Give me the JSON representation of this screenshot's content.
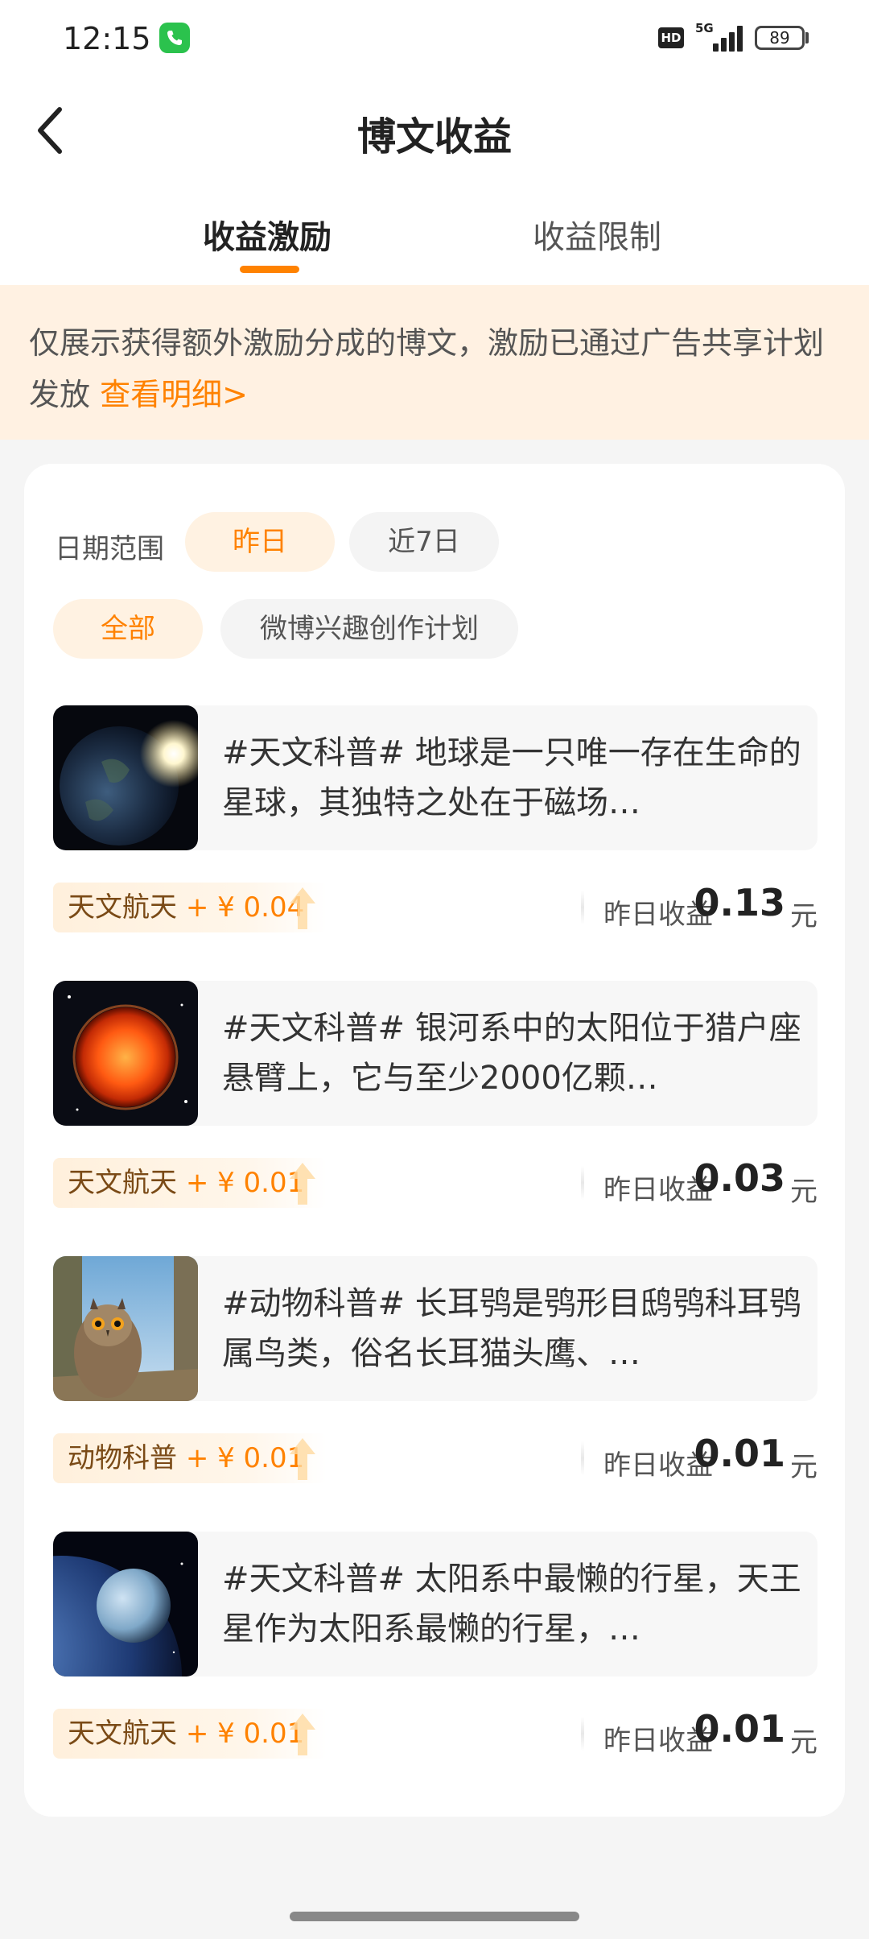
{
  "status_bar": {
    "time": "12:15",
    "hd": "HD",
    "network": "5G",
    "battery": "89"
  },
  "header": {
    "title": "博文收益"
  },
  "tabs": [
    {
      "label": "收益激励",
      "active": true
    },
    {
      "label": "收益限制",
      "active": false
    }
  ],
  "notice": {
    "text": "仅展示获得额外激励分成的博文，激励已通过广告共享计划发放 ",
    "link": "查看明细>"
  },
  "filters": {
    "date_label": "日期范围",
    "date_options": [
      {
        "label": "昨日",
        "active": true
      },
      {
        "label": "近7日",
        "active": false
      }
    ],
    "type_options": [
      {
        "label": "全部",
        "active": true
      },
      {
        "label": "微博兴趣创作计划",
        "active": false
      }
    ]
  },
  "posts": [
    {
      "thumbnail": "earth-image",
      "text": "#天文科普# 地球是一只唯一存在生命的星球，其独特之处在于磁场…",
      "category": "天文航天",
      "bonus": "+ ¥ 0.04",
      "earn_label": "昨日收益",
      "earn_value": "0.13",
      "unit": "元"
    },
    {
      "thumbnail": "sun-image",
      "text": "#天文科普# 银河系中的太阳位于猎户座悬臂上，它与至少2000亿颗…",
      "category": "天文航天",
      "bonus": "+ ¥ 0.01",
      "earn_label": "昨日收益",
      "earn_value": "0.03",
      "unit": "元"
    },
    {
      "thumbnail": "owl-image",
      "text": "#动物科普# 长耳鸮是鸮形目鸱鸮科耳鸮属鸟类，俗名长耳猫头鹰、…",
      "category": "动物科普",
      "bonus": "+ ¥ 0.01",
      "earn_label": "昨日收益",
      "earn_value": "0.01",
      "unit": "元"
    },
    {
      "thumbnail": "uranus-image",
      "text": "#天文科普# 太阳系中最懒的行星，天王星作为太阳系最懒的行星，…",
      "category": "天文航天",
      "bonus": "+ ¥ 0.01",
      "earn_label": "昨日收益",
      "earn_value": "0.01",
      "unit": "元"
    }
  ],
  "colors": {
    "accent": "#ff8200",
    "notice_bg": "#fff1e2",
    "page_bg": "#f5f5f5"
  }
}
